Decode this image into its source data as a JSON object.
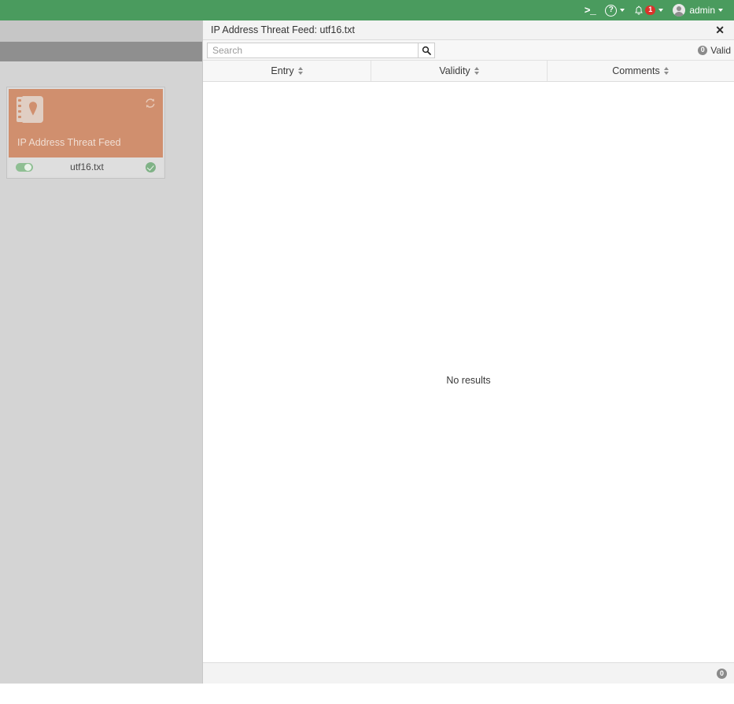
{
  "topbar": {
    "background_color": "#4a9b5e",
    "terminal_icon_label": ">_",
    "help_icon_label": "?",
    "notifications_count": "1",
    "user_label": "admin"
  },
  "left_pane": {
    "card": {
      "title": "IP Address Threat Feed",
      "file_name": "utf16.txt",
      "accent_color": "#d08f6e",
      "toggle_state": "on",
      "status": "valid"
    }
  },
  "panel": {
    "title": "IP Address Threat Feed: utf16.txt",
    "close_label": "✕",
    "search": {
      "value": "",
      "placeholder": "Search"
    },
    "valid_count": "0",
    "valid_label": "Valid",
    "table": {
      "columns": [
        {
          "label": "Entry"
        },
        {
          "label": "Validity"
        },
        {
          "label": "Comments"
        }
      ],
      "rows": [],
      "empty_message": "No results"
    },
    "footer_count": "0"
  }
}
